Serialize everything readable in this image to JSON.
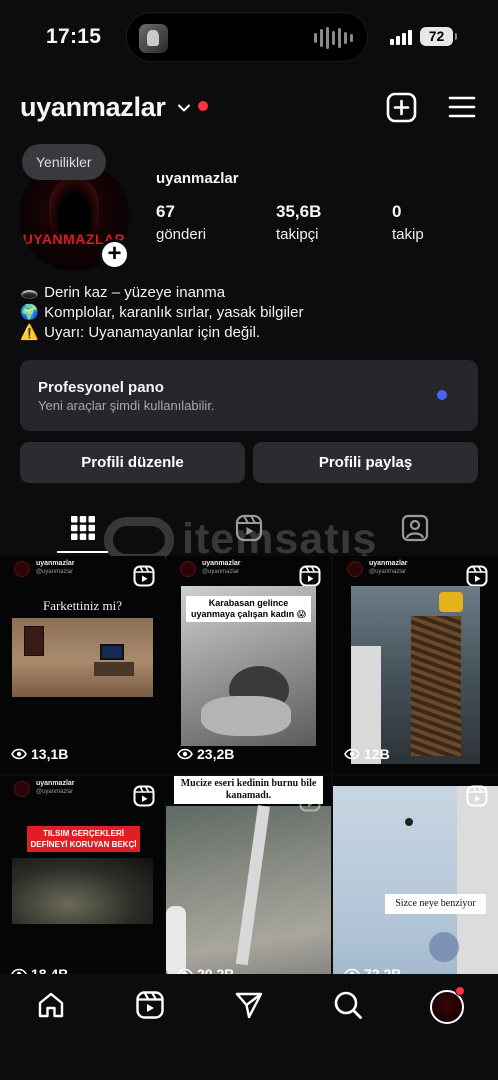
{
  "status_bar": {
    "time": "17:15",
    "battery": "72"
  },
  "header": {
    "username": "uyanmazlar",
    "icons": [
      "chevron-down-icon",
      "notification-dot",
      "plus-square-icon",
      "hamburger-menu-icon"
    ]
  },
  "profile": {
    "note": "Yenilikler",
    "avatar_text": "UYANMAZLAR",
    "name": "uyanmazlar",
    "stats": [
      {
        "value": "67",
        "label": "gönderi"
      },
      {
        "value": "35,6B",
        "label": "takipçi"
      },
      {
        "value": "0",
        "label": "takip"
      }
    ],
    "bio": [
      {
        "emoji": "🕳️",
        "text": "Derin kaz – yüzeye inanma"
      },
      {
        "emoji": "🌍",
        "text": "Komplolar, karanlık sırlar, yasak bilgiler"
      },
      {
        "emoji": "⚠️",
        "text": "Uyarı: Uyanamayanlar için değil."
      }
    ]
  },
  "dashboard": {
    "title": "Profesyonel pano",
    "subtitle": "Yeni araçlar şimdi kullanılabilir."
  },
  "actions": {
    "edit": "Profili düzenle",
    "share": "Profili paylaş"
  },
  "tabs": [
    "grid-icon",
    "reels-icon",
    "tagged-icon"
  ],
  "watermark": "itemsatış",
  "posts": [
    {
      "account": "uyanmazlar",
      "handle": "@uyanmazlar",
      "caption": "Farkettiniz mi?",
      "views": "13,1B"
    },
    {
      "account": "uyanmazlar",
      "handle": "@uyanmazlar",
      "caption": "Karabasan gelince uyanmaya çalışan kadın 😱",
      "views": "23,2B"
    },
    {
      "account": "uyanmazlar",
      "handle": "@uyanmazlar",
      "caption": "",
      "views": "12B"
    },
    {
      "account": "uyanmazlar",
      "handle": "@uyanmazlar",
      "caption": "TILSIM GERÇEKLERİ DEFİNEYİ KORUYAN BEKÇİ",
      "views": "18,4B"
    },
    {
      "account": "",
      "handle": "",
      "caption": "Mucize eseri kedinin burnu bile kanamadı.",
      "views": "20,2B"
    },
    {
      "account": "",
      "handle": "",
      "caption": "Sizce neye benziyor",
      "views": "72,2B"
    }
  ],
  "bottom_nav": [
    "home-icon",
    "reels-icon",
    "send-icon",
    "search-icon",
    "profile-avatar"
  ],
  "colors": {
    "background": "#0c0c0e",
    "card": "#26272b",
    "button": "#2b2c30",
    "accent_red": "#ff3040",
    "accent_blue": "#4a63f5"
  }
}
